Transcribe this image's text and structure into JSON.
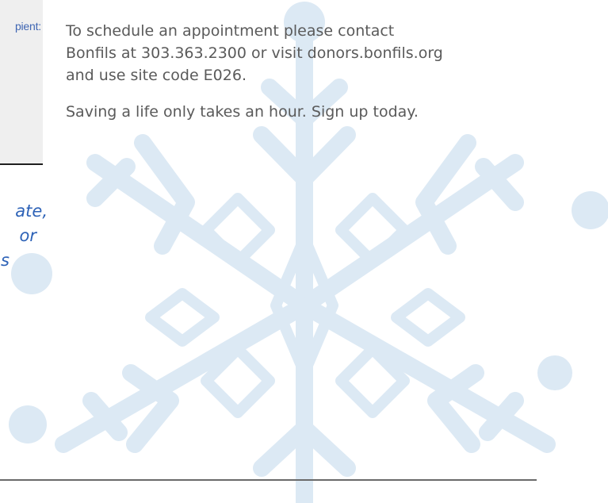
{
  "left_panel": {
    "label_fragment": "pient:"
  },
  "left_italic": {
    "line1": "ate,",
    "line2": "or",
    "line3": "s"
  },
  "main": {
    "line1": "To schedule an appointment please contact",
    "line2": "Bonfils at 303.363.2300 or visit donors.bonfils.org",
    "line3": "and use site code E026.",
    "paragraph2": "Saving a life only takes an hour. Sign up today."
  },
  "colors": {
    "snowflake": "#dce9f4",
    "body_text": "#5a5a5a",
    "italic_text": "#2d62b7",
    "panel_label": "#3f66b3",
    "panel_bg": "#efefef"
  },
  "decorations": {
    "background_icon": "snowflake-icon"
  }
}
